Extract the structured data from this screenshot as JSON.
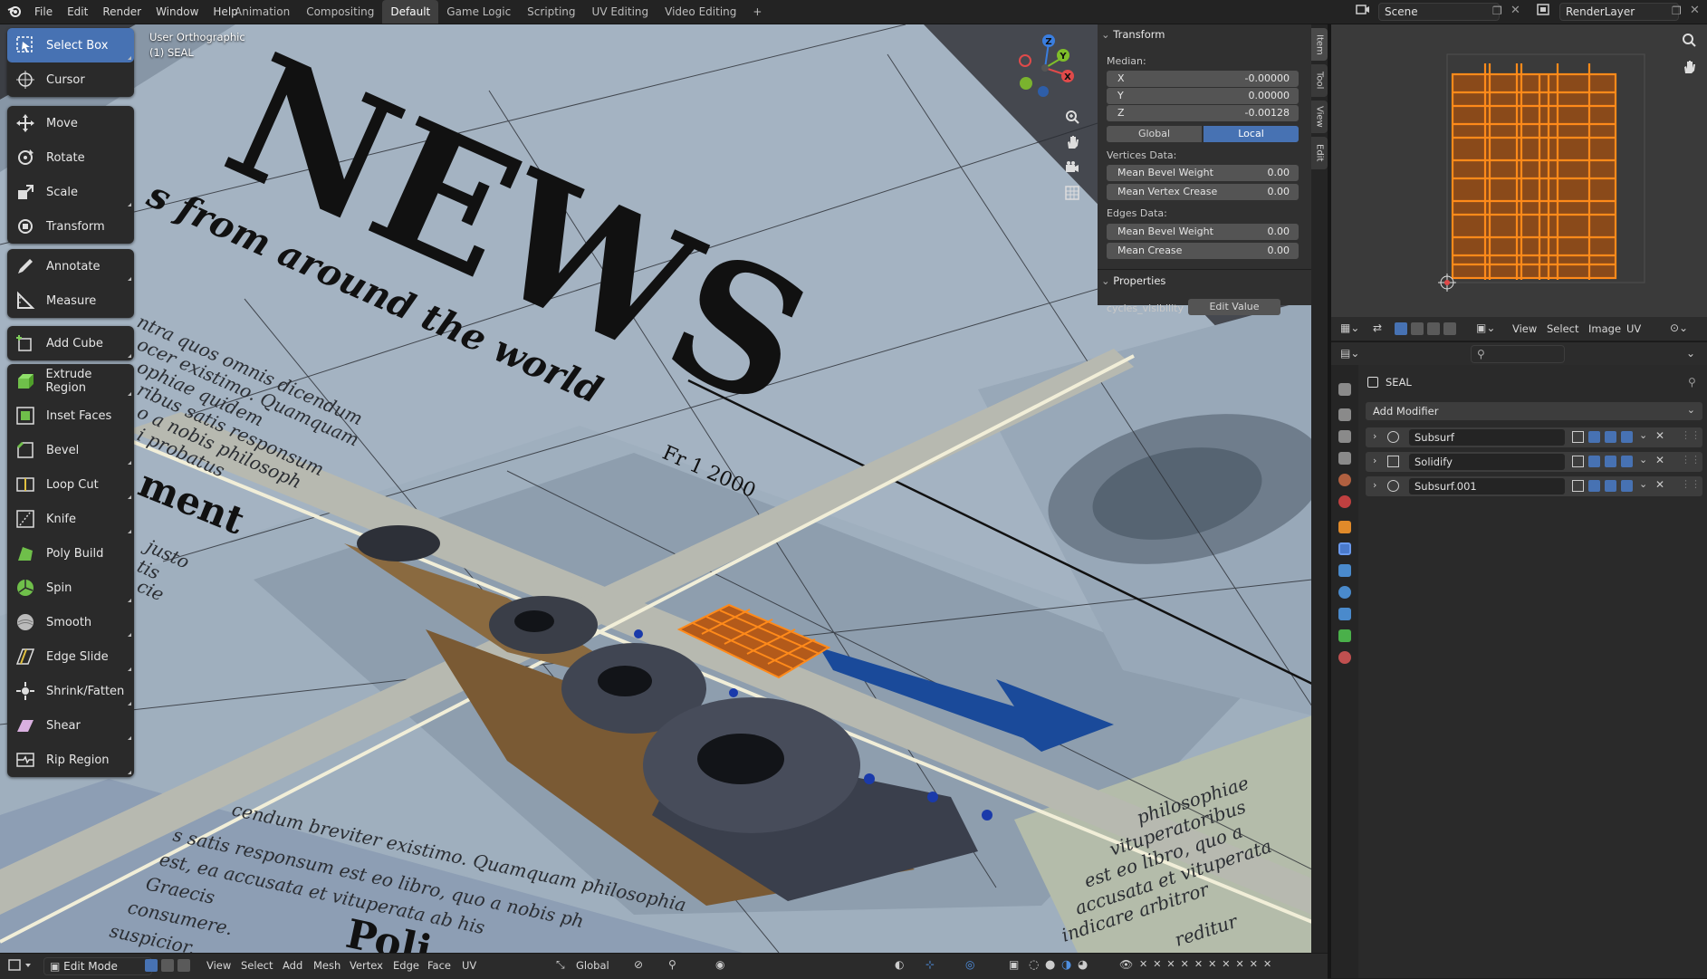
{
  "topbar": {
    "menus": [
      "File",
      "Edit",
      "Render",
      "Window",
      "Help"
    ],
    "workspaces": [
      "Animation",
      "Compositing",
      "Default",
      "Game Logic",
      "Scripting",
      "UV Editing",
      "Video Editing"
    ],
    "active_workspace": "Default",
    "add_tab": "+",
    "scene": "Scene",
    "render_layer": "RenderLayer"
  },
  "viewport": {
    "view_name": "User Orthographic",
    "object_name": "(1) SEAL",
    "newspaper": {
      "headline": "NEWS",
      "tagline": "s from around the world",
      "date": "Fr      1 2000",
      "section": "ment",
      "section2": "Poli",
      "latin_top": [
        "ntra quos omnis dicendum",
        "ocer existimo. Quamquam",
        "ophiae quidem",
        "ribus satis responsum",
        "o a nobis philosoph",
        "i probatus"
      ],
      "latin_left": [
        "justo",
        "tis",
        "cie"
      ],
      "latin_bottom": [
        "cendum breviter existimo. Quamquam philosophia",
        "s satis responsum est eo libro, quo a nobis ph",
        "est, ea accusata et vituperata ab his",
        "Graecis",
        "consumere.",
        "suspicior."
      ],
      "latin_right": [
        "philosophiae",
        "vituperatoribus",
        "est eo libro, quo a",
        "accusata et vituperata",
        "indicare arbitror",
        "reditur"
      ]
    },
    "axes": {
      "z": "Z",
      "y": "Y",
      "x": "X"
    }
  },
  "toolbar": {
    "groups": [
      [
        "Select Box",
        "Cursor"
      ],
      [
        "Move",
        "Rotate",
        "Scale",
        "Transform"
      ],
      [
        "Annotate",
        "Measure"
      ],
      [
        "Add Cube"
      ],
      [
        "Extrude Region",
        "Inset Faces",
        "Bevel",
        "Loop Cut",
        "Knife",
        "Poly Build",
        "Spin",
        "Smooth",
        "Edge Slide",
        "Shrink/Fatten",
        "Shear",
        "Rip Region"
      ]
    ],
    "active": "Select Box"
  },
  "npanel": {
    "transform_title": "Transform",
    "median_label": "Median:",
    "x": {
      "label": "X",
      "value": "-0.00000"
    },
    "y": {
      "label": "Y",
      "value": "0.00000"
    },
    "z": {
      "label": "Z",
      "value": "-0.00128"
    },
    "global_label": "Global",
    "local_label": "Local",
    "vertices_label": "Vertices Data:",
    "mean_bevel_weight_v": {
      "label": "Mean Bevel Weight",
      "value": "0.00"
    },
    "mean_vertex_crease": {
      "label": "Mean Vertex Crease",
      "value": "0.00"
    },
    "edges_label": "Edges Data:",
    "mean_bevel_weight_e": {
      "label": "Mean Bevel Weight",
      "value": "0.00"
    },
    "mean_crease": {
      "label": "Mean Crease",
      "value": "0.00"
    },
    "properties_title": "Properties",
    "prop_name": "cycles_visibility",
    "prop_button": "Edit Value",
    "tabs": [
      "Item",
      "Tool",
      "View",
      "Edit"
    ]
  },
  "bottombar": {
    "mode": "Edit Mode",
    "menus": [
      "View",
      "Select",
      "Add",
      "Mesh",
      "Vertex",
      "Edge",
      "Face",
      "UV"
    ],
    "orientation": "Global"
  },
  "uv_editor": {
    "menus": [
      "View",
      "Select",
      "Image",
      "UV"
    ]
  },
  "properties": {
    "object_name": "SEAL",
    "add_modifier": "Add Modifier",
    "modifiers": [
      "Subsurf",
      "Solidify",
      "Subsurf.001"
    ]
  },
  "colors": {
    "accent": "#4772b3",
    "selection": "#ff8a1a",
    "paper": "#a9b6c4",
    "viewport_bg": "#3d4048"
  }
}
